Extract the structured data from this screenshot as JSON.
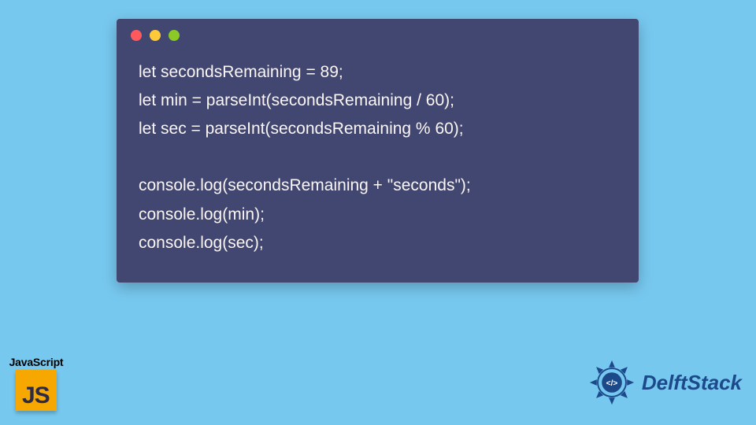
{
  "code": {
    "lines": [
      "let secondsRemaining = 89;",
      "let min = parseInt(secondsRemaining / 60);",
      "let sec = parseInt(secondsRemaining % 60);",
      "",
      "console.log(secondsRemaining + \"seconds\");",
      "console.log(min);",
      "console.log(sec);"
    ]
  },
  "jsBadge": {
    "label": "JavaScript",
    "short": "JS"
  },
  "brand": {
    "name": "DelftStack"
  },
  "colors": {
    "page_bg": "#77c8ef",
    "window_bg": "#414770",
    "code_fg": "#fbf5f3",
    "dot_red": "#ff595e",
    "dot_yellow": "#ffca3a",
    "dot_green": "#8ac926",
    "js_bg": "#f7a800",
    "brand_blue": "#1c498a"
  }
}
